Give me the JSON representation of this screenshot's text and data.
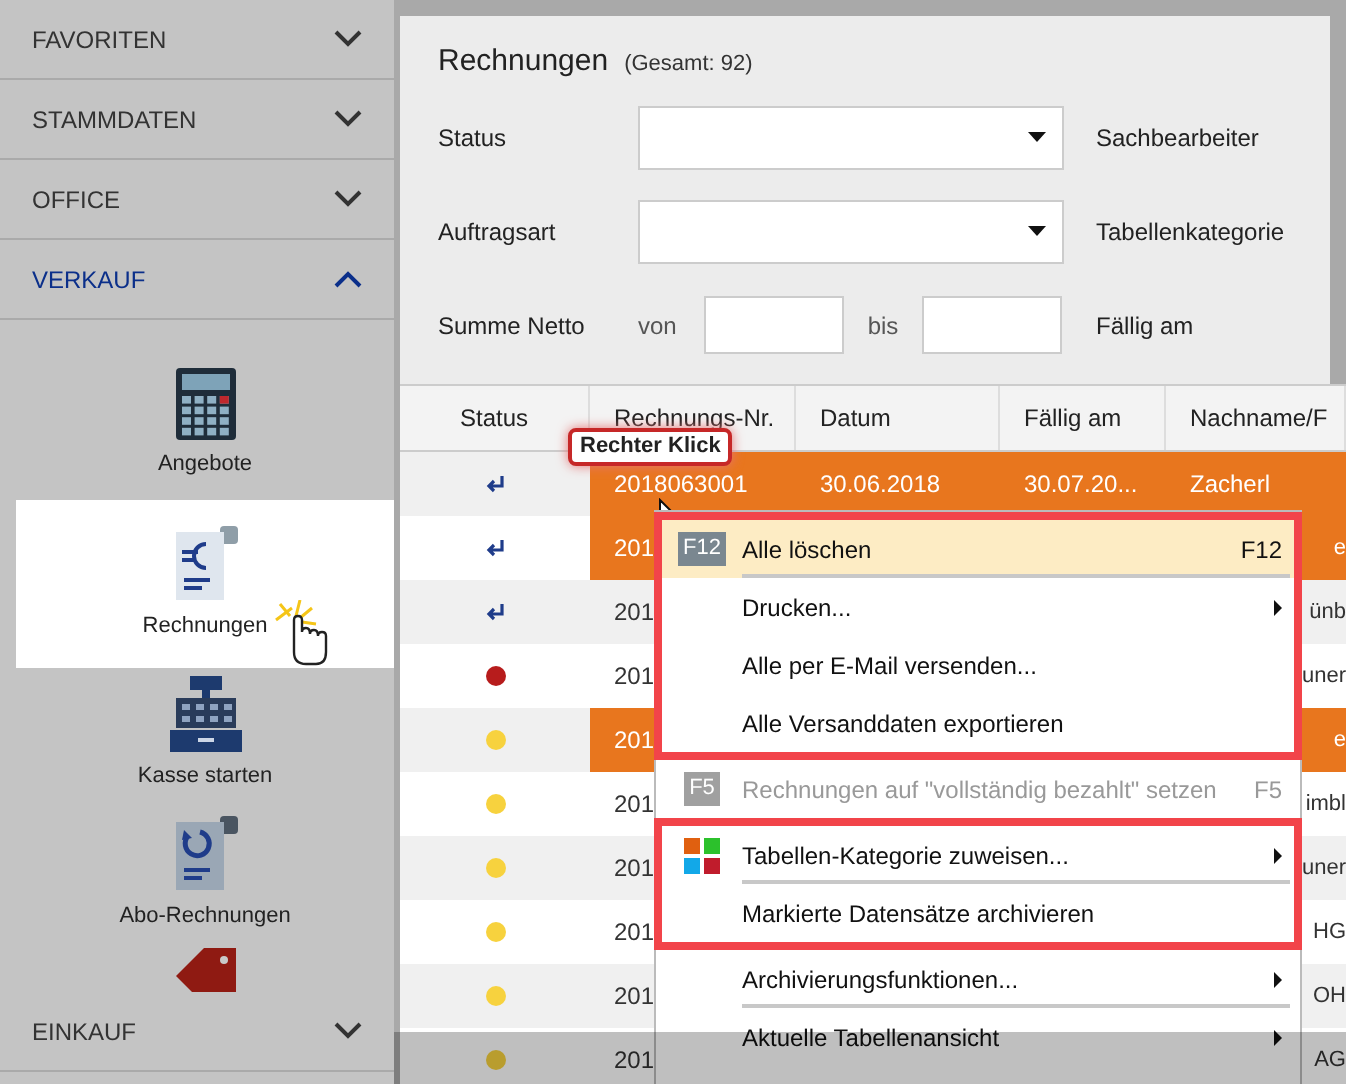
{
  "sidebar": {
    "sections": [
      {
        "label": "FAVORITEN",
        "expanded": false
      },
      {
        "label": "STAMMDATEN",
        "expanded": false
      },
      {
        "label": "OFFICE",
        "expanded": false
      },
      {
        "label": "VERKAUF",
        "expanded": true,
        "items": [
          {
            "label": "Angebote",
            "kind": "calculator",
            "selected": false
          },
          {
            "label": "Rechnungen",
            "kind": "invoice",
            "selected": true
          },
          {
            "label": "Kasse starten",
            "kind": "register",
            "selected": false
          },
          {
            "label": "Abo-Rechnungen",
            "kind": "recurring",
            "selected": false
          },
          {
            "kind": "tag",
            "selected": false
          }
        ]
      },
      {
        "label": "EINKAUF",
        "expanded": false
      }
    ]
  },
  "page": {
    "title": "Rechnungen",
    "count": "(Gesamt: 92)",
    "filters": [
      {
        "label": "Status",
        "kind": "select",
        "right_label": "Sachbearbeiter"
      },
      {
        "label": "Auftragsart",
        "kind": "select",
        "right_label": "Tabellenkategorie"
      },
      {
        "label": "Summe Netto",
        "kind": "range",
        "from": "von",
        "to": "bis",
        "right_label": "Fällig am"
      }
    ]
  },
  "table": {
    "columns": [
      "Status",
      "Rechnungs-Nr.",
      "Datum",
      "Fällig am",
      "Nachname/F"
    ],
    "rows": [
      {
        "kind": "arrow",
        "nr": "2018063001",
        "datum": "30.06.2018",
        "faellig": "30.07.20...",
        "name": "Zacherl",
        "selected": true
      },
      {
        "kind": "arrow",
        "nr": "201",
        "name": "e",
        "selected": true
      },
      {
        "kind": "arrow",
        "nr": "201",
        "name": "ünb",
        "selected": false
      },
      {
        "kind": "red",
        "nr": "201",
        "name": "uner",
        "selected": false
      },
      {
        "kind": "yellow",
        "nr": "201",
        "name": "e",
        "selected": true
      },
      {
        "kind": "yellow",
        "nr": "201",
        "name": "imbl",
        "selected": false
      },
      {
        "kind": "yellow",
        "nr": "201",
        "name": "uner",
        "selected": false
      },
      {
        "kind": "yellow",
        "nr": "201",
        "name": "HG",
        "selected": false
      },
      {
        "kind": "yellow",
        "nr": "201",
        "name": "OH",
        "selected": false
      },
      {
        "kind": "yellow",
        "nr": "201",
        "name": "AG",
        "selected": false
      }
    ]
  },
  "tooltip": "Rechter Klick",
  "context_menu": {
    "groups": [
      {
        "framed": true,
        "items": [
          {
            "label": "Alle löschen",
            "badge": "F12",
            "shortcut": "F12",
            "highlighted": true,
            "disabled": false,
            "submenu": false,
            "separator_after": true
          },
          {
            "label": "Drucken...",
            "highlighted": false,
            "disabled": false,
            "submenu": true,
            "separator_after": false
          },
          {
            "label": "Alle per E-Mail versenden...",
            "highlighted": false,
            "disabled": false,
            "submenu": false,
            "separator_after": false
          },
          {
            "label": "Alle Versanddaten exportieren",
            "highlighted": false,
            "disabled": false,
            "submenu": false,
            "separator_after": false
          }
        ]
      },
      {
        "framed": false,
        "items": [
          {
            "label": "Rechnungen auf \"vollständig bezahlt\" setzen",
            "badge": "F5",
            "shortcut": "F5",
            "highlighted": false,
            "disabled": true,
            "submenu": false,
            "separator_after": false
          }
        ]
      },
      {
        "framed": true,
        "items": [
          {
            "label": "Tabellen-Kategorie zuweisen...",
            "kind": "colored",
            "highlighted": false,
            "disabled": false,
            "submenu": true,
            "separator_after": true
          },
          {
            "label": "Markierte Datensätze archivieren",
            "highlighted": false,
            "disabled": false,
            "submenu": false,
            "separator_after": false
          }
        ]
      },
      {
        "framed": false,
        "items": [
          {
            "label": "Archivierungsfunktionen...",
            "highlighted": false,
            "disabled": false,
            "submenu": true,
            "separator_after": true
          },
          {
            "label": "Aktuelle Tabellenansicht",
            "highlighted": false,
            "disabled": false,
            "submenu": true,
            "separator_after": false
          }
        ]
      }
    ]
  }
}
